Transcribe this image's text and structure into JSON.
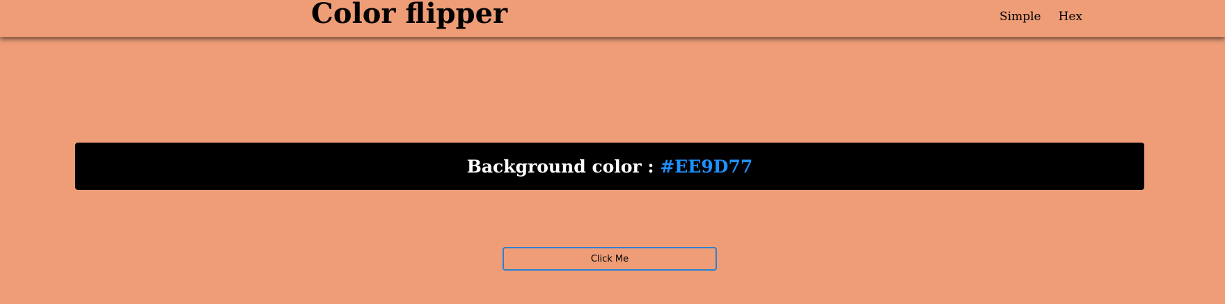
{
  "app": {
    "title": "Color flipper"
  },
  "nav": {
    "links": [
      {
        "label": "Simple"
      },
      {
        "label": "Hex"
      }
    ]
  },
  "main": {
    "banner_label": "Background color : ",
    "color_value": "#EE9D77",
    "button_label": "Click Me"
  },
  "colors": {
    "page_background": "#EE9D77",
    "banner_background": "#000000",
    "banner_text": "#ffffff",
    "color_value_text": "#1E90FF",
    "button_border": "#2F7FD0"
  }
}
